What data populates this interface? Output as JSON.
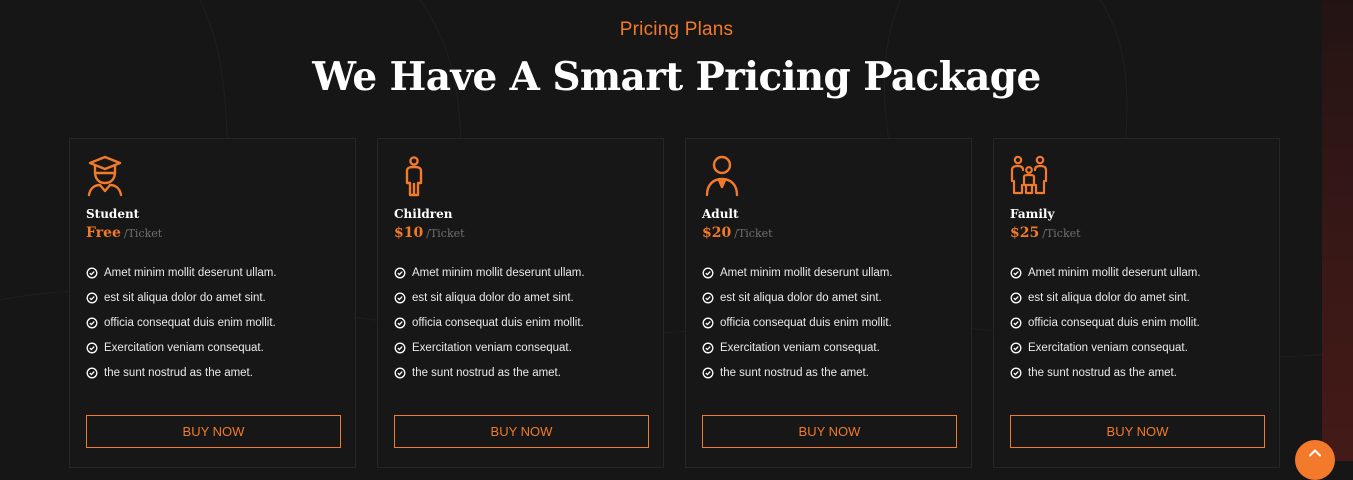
{
  "header": {
    "eyebrow": "Pricing Plans",
    "title": "We Have A Smart Pricing Package"
  },
  "colors": {
    "accent": "#f27a2a",
    "background": "#161616",
    "card_border": "#262626"
  },
  "plans": [
    {
      "name": "Student",
      "price": "Free",
      "unit": "/Ticket",
      "icon": "graduate-icon",
      "features": [
        "Amet minim mollit deserunt ullam.",
        "est sit aliqua dolor do amet sint.",
        "officia consequat duis enim mollit.",
        "Exercitation veniam consequat.",
        "the sunt nostrud as the amet."
      ],
      "button": "BUY NOW"
    },
    {
      "name": "Children",
      "price": "$10",
      "unit": "/Ticket",
      "icon": "child-icon",
      "features": [
        "Amet minim mollit deserunt ullam.",
        "est sit aliqua dolor do amet sint.",
        "officia consequat duis enim mollit.",
        "Exercitation veniam consequat.",
        "the sunt nostrud as the amet."
      ],
      "button": "BUY NOW"
    },
    {
      "name": "Adult",
      "price": "$20",
      "unit": "/Ticket",
      "icon": "adult-icon",
      "features": [
        "Amet minim mollit deserunt ullam.",
        "est sit aliqua dolor do amet sint.",
        "officia consequat duis enim mollit.",
        "Exercitation veniam consequat.",
        "the sunt nostrud as the amet."
      ],
      "button": "BUY NOW"
    },
    {
      "name": "Family",
      "price": "$25",
      "unit": "/Ticket",
      "icon": "family-icon",
      "features": [
        "Amet minim mollit deserunt ullam.",
        "est sit aliqua dolor do amet sint.",
        "officia consequat duis enim mollit.",
        "Exercitation veniam consequat.",
        "the sunt nostrud as the amet."
      ],
      "button": "BUY NOW"
    }
  ],
  "scroll_top": {
    "icon": "chevron-up-icon"
  }
}
